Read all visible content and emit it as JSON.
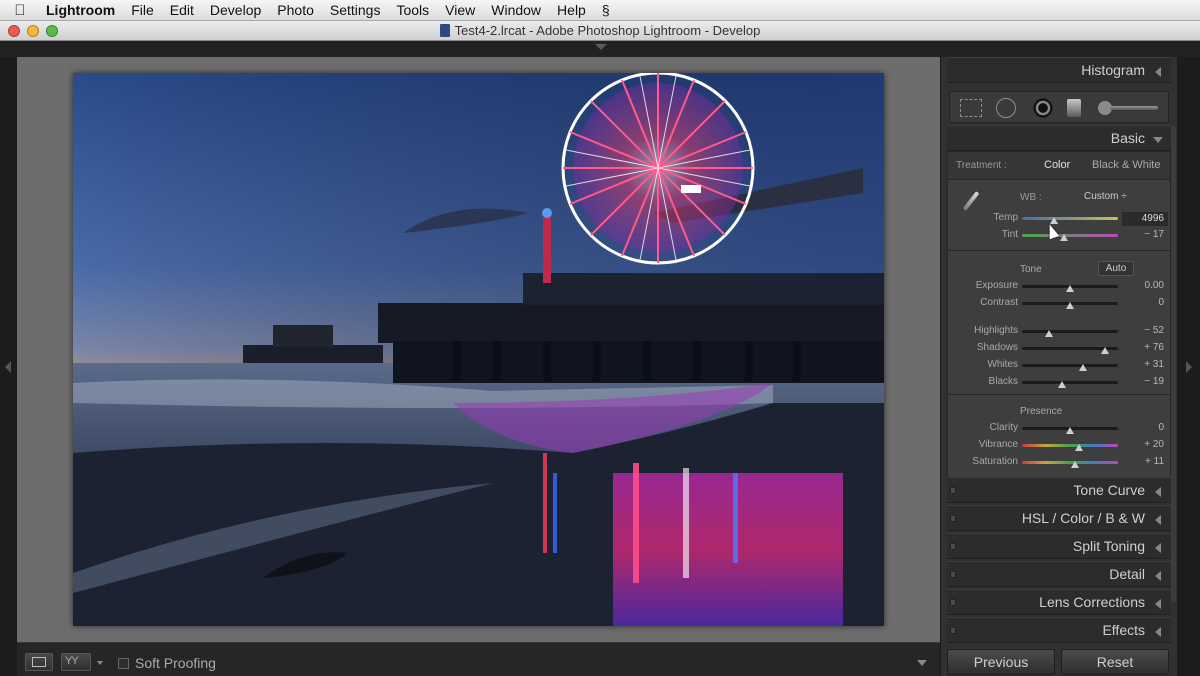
{
  "menubar": {
    "app": "Lightroom",
    "items": [
      "File",
      "Edit",
      "Develop",
      "Photo",
      "Settings",
      "Tools",
      "View",
      "Window",
      "Help"
    ]
  },
  "window": {
    "title": "Test4-2.lrcat - Adobe Photoshop Lightroom - Develop"
  },
  "toolbar": {
    "compare_label": "YY",
    "soft_proofing": "Soft Proofing",
    "soft_proofing_checked": false
  },
  "right_panel": {
    "histogram": "Histogram",
    "basic": "Basic",
    "treatment": {
      "label": "Treatment :",
      "color": "Color",
      "bw": "Black & White",
      "selected": "Color"
    },
    "wb": {
      "label": "WB :",
      "preset": "Custom ÷"
    },
    "sliders_wb": [
      {
        "label": "Temp",
        "value": "4996",
        "pos": 0.33,
        "track": "temp"
      },
      {
        "label": "Tint",
        "value": "− 17",
        "pos": 0.44,
        "track": "tint"
      }
    ],
    "tone": {
      "title": "Tone",
      "auto": "Auto"
    },
    "sliders_tone": [
      {
        "label": "Exposure",
        "value": "0.00",
        "pos": 0.5
      },
      {
        "label": "Contrast",
        "value": "0",
        "pos": 0.5
      }
    ],
    "sliders_hs": [
      {
        "label": "Highlights",
        "value": "− 52",
        "pos": 0.28
      },
      {
        "label": "Shadows",
        "value": "+ 76",
        "pos": 0.86
      },
      {
        "label": "Whites",
        "value": "+ 31",
        "pos": 0.64
      },
      {
        "label": "Blacks",
        "value": "− 19",
        "pos": 0.42
      }
    ],
    "presence": {
      "title": "Presence"
    },
    "sliders_presence": [
      {
        "label": "Clarity",
        "value": "0",
        "pos": 0.5,
        "track": ""
      },
      {
        "label": "Vibrance",
        "value": "+ 20",
        "pos": 0.59,
        "track": "vib"
      },
      {
        "label": "Saturation",
        "value": "+ 11",
        "pos": 0.55,
        "track": "sat"
      }
    ],
    "collapsed_panels": [
      {
        "id": "tone-curve",
        "label": "Tone Curve"
      },
      {
        "id": "hsl",
        "label": "HSL / Color / B & W"
      },
      {
        "id": "split-toning",
        "label": "Split Toning"
      },
      {
        "id": "detail",
        "label": "Detail"
      },
      {
        "id": "lens-corrections",
        "label": "Lens Corrections"
      },
      {
        "id": "effects",
        "label": "Effects"
      }
    ],
    "buttons": {
      "previous": "Previous",
      "reset": "Reset"
    }
  },
  "colors": {
    "panel_bg": "#313131",
    "canvas_bg": "#6d6d6d",
    "text": "#cfcfcf"
  }
}
